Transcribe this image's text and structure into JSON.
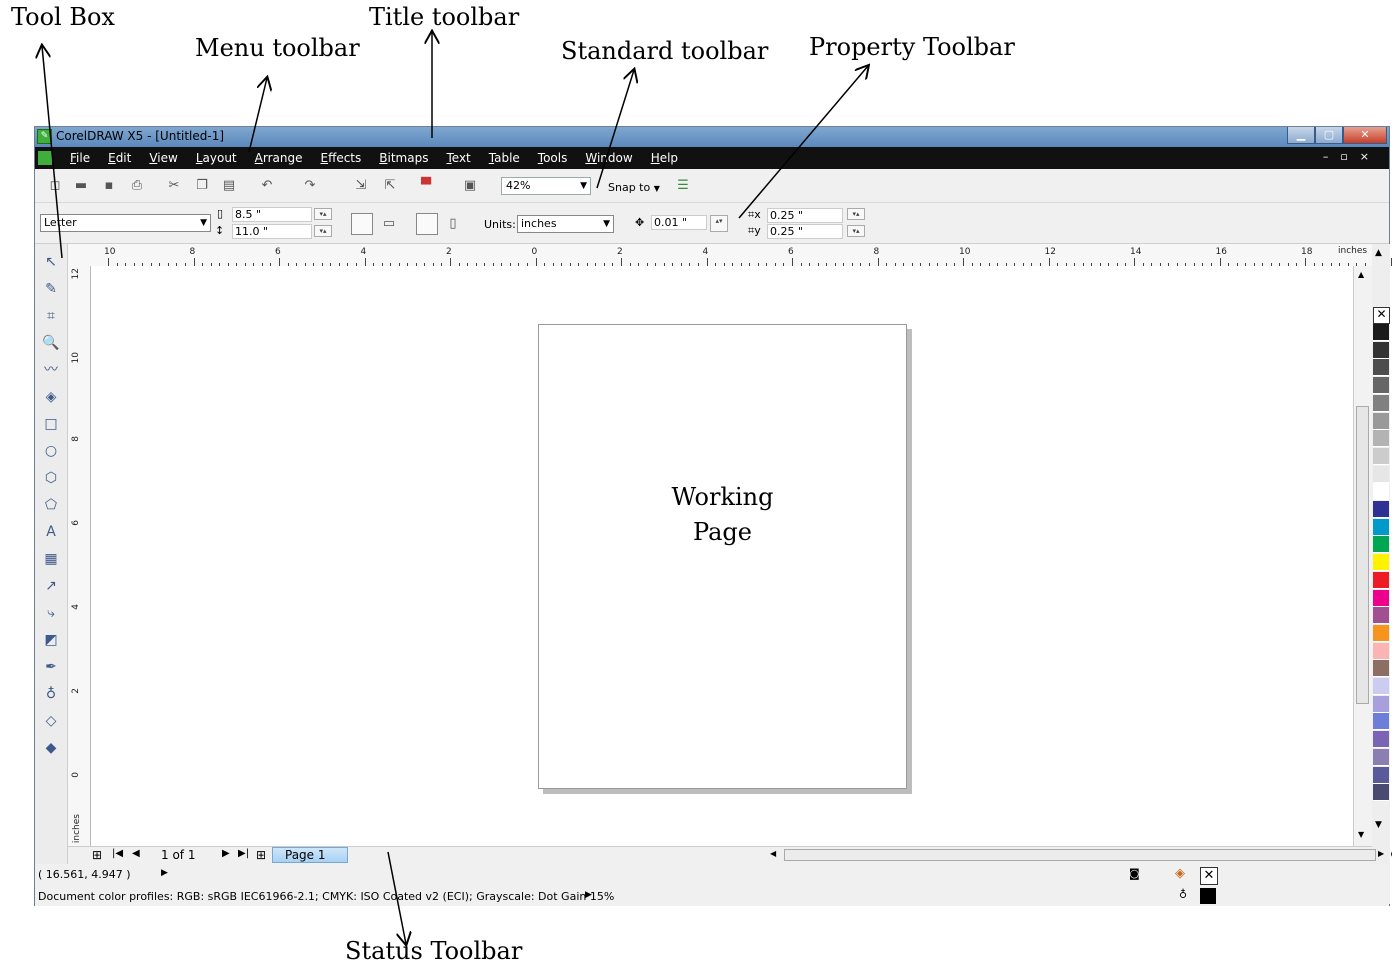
{
  "annotations": {
    "tool_box": "Tool Box",
    "menu_toolbar": "Menu toolbar",
    "title_toolbar": "Title toolbar",
    "standard_toolbar": "Standard toolbar",
    "property_toolbar": "Property Toolbar",
    "status_toolbar": "Status Toolbar"
  },
  "window": {
    "title": "CorelDRAW X5 - [Untitled-1]",
    "buttons": [
      "minimize-icon",
      "maximize-icon",
      "close-icon"
    ]
  },
  "menu": {
    "items": [
      "File",
      "Edit",
      "View",
      "Layout",
      "Arrange",
      "Effects",
      "Bitmaps",
      "Text",
      "Table",
      "Tools",
      "Window",
      "Help"
    ]
  },
  "standard_toolbar": {
    "icons": [
      "new-icon",
      "open-icon",
      "save-icon",
      "print-icon",
      "cut-icon",
      "copy-icon",
      "paste-icon",
      "undo-icon",
      "redo-icon",
      "import-icon",
      "export-icon",
      "application-launcher-icon",
      "welcome-screen-icon"
    ],
    "zoom_value": "42%",
    "snap_label": "Snap to"
  },
  "property_toolbar": {
    "paper_preset": "Letter",
    "width": "8.5 \"",
    "height": "11.0 \"",
    "units_label": "Units:",
    "units_value": "inches",
    "nudge": "0.01 \"",
    "dup_x": "0.25 \"",
    "dup_y": "0.25 \""
  },
  "rulers": {
    "horizontal_labels": [
      "10",
      "8",
      "6",
      "4",
      "2",
      "0",
      "2",
      "4",
      "6",
      "8",
      "10",
      "12",
      "14",
      "16",
      "18"
    ],
    "unit": "inches",
    "vertical_labels": [
      "12",
      "10",
      "8",
      "6",
      "4",
      "2",
      "0"
    ],
    "vertical_unit": "inches"
  },
  "toolbox": {
    "tools": [
      "pick-tool-icon",
      "shape-tool-icon",
      "crop-tool-icon",
      "zoom-tool-icon",
      "freehand-tool-icon",
      "smart-fill-tool-icon",
      "rectangle-tool-icon",
      "ellipse-tool-icon",
      "polygon-tool-icon",
      "basic-shapes-tool-icon",
      "text-tool-icon",
      "table-tool-icon",
      "dimension-tool-icon",
      "connector-tool-icon",
      "blend-tool-icon",
      "eyedropper-tool-icon",
      "outline-pen-tool-icon",
      "fill-tool-icon",
      "interactive-fill-tool-icon"
    ]
  },
  "page": {
    "line1": "Working",
    "line2": "Page"
  },
  "page_nav": {
    "page_count": "1 of 1",
    "tab_label": "Page 1"
  },
  "status": {
    "coordinates": "( 16.561, 4.947 )",
    "color_profiles": "Document color profiles: RGB: sRGB IEC61966-2.1; CMYK: ISO Coated v2 (ECI); Grayscale: Dot Gain 15%"
  },
  "palette": {
    "colors": [
      "#1a1a1a",
      "#333333",
      "#4d4d4d",
      "#666666",
      "#808080",
      "#999999",
      "#b3b3b3",
      "#cccccc",
      "#e6e6e6",
      "#ffffff",
      "#2e3192",
      "#0099cc",
      "#00a651",
      "#fff200",
      "#ed1c24",
      "#ec008c",
      "#a05090",
      "#f7941d",
      "#fbb4b4",
      "#8c6e63",
      "#ccccf0",
      "#a8a0dc",
      "#6c7ed8",
      "#7b64b4",
      "#8a7fb0",
      "#5a5a9a",
      "#4a4a70"
    ]
  }
}
